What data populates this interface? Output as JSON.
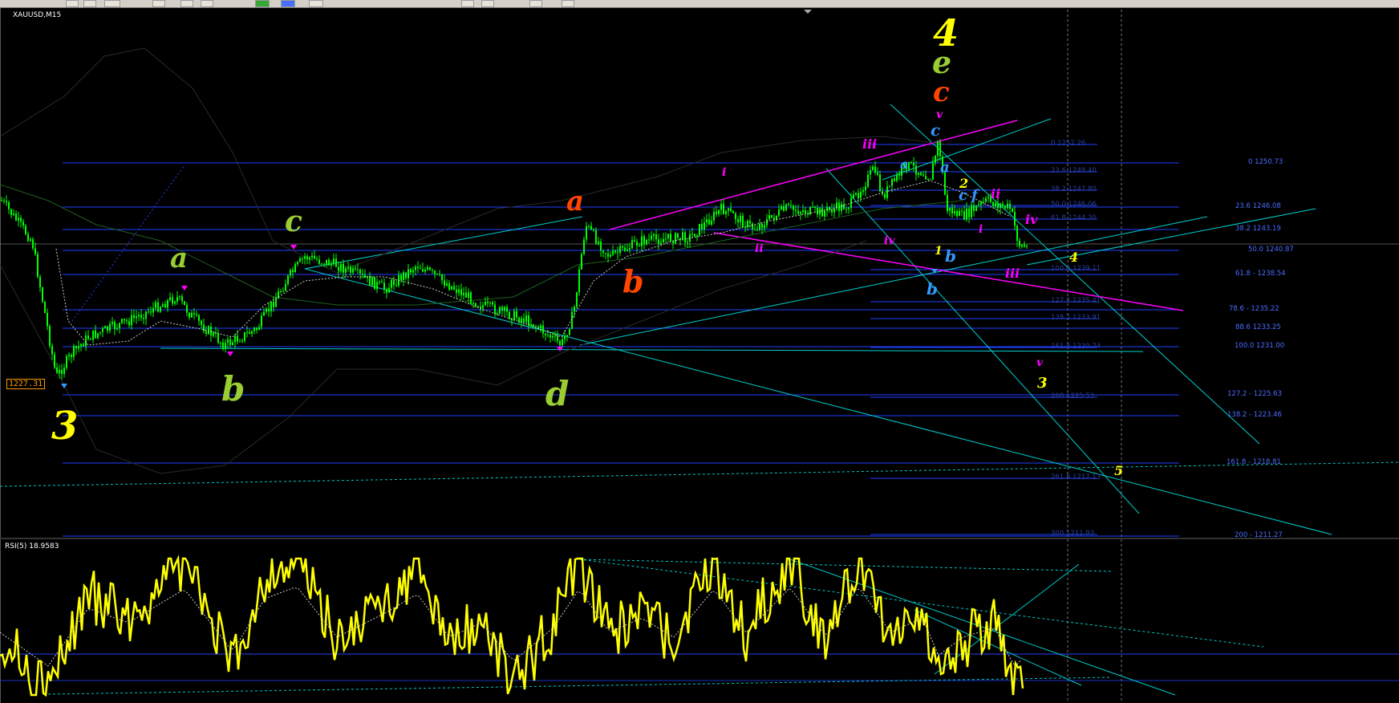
{
  "window": {
    "title": "XAUUSD,M15"
  },
  "rsi": {
    "title": "RSI(5) 18.9583"
  },
  "price_box": "1227.31",
  "colors": {
    "background": "#000000",
    "candles": "#00ff00",
    "fib_lines": "#2040ff",
    "trend_lines": "#00d0d0",
    "magenta_lines": "#ff00ff",
    "rsi_line": "#ffff00"
  },
  "fib_labels_right": [
    {
      "text": "0 1250.73"
    },
    {
      "text": "23.6 1246.08"
    },
    {
      "text": "38.2 1243.19"
    },
    {
      "text": "50.0 1240.87"
    },
    {
      "text": "61.8 - 1238.54"
    },
    {
      "text": "78.6 - 1235.22"
    },
    {
      "text": "88.6 1233.25"
    },
    {
      "text": "100.0 1231.00"
    },
    {
      "text": "127.2 - 1225.63"
    },
    {
      "text": "138.2 - 1223.46"
    },
    {
      "text": "161.8 - 1218.81"
    },
    {
      "text": "200 - 1211.27"
    }
  ],
  "fib_labels_inner": [
    {
      "text": "0 1252.26"
    },
    {
      "text": "23.6 1249.40"
    },
    {
      "text": "38.2 1247.80"
    },
    {
      "text": "50.0 1246.06"
    },
    {
      "text": "61.8 1244.30"
    },
    {
      "text": "100.0 1239.11"
    },
    {
      "text": "127.2 1235.41"
    },
    {
      "text": "138.2 1233.91"
    },
    {
      "text": "161.8 1230.74"
    },
    {
      "text": "200 1225.53"
    },
    {
      "text": "261.8 1217.13"
    },
    {
      "text": "300 1211.93"
    }
  ],
  "wave_labels": [
    {
      "text": "4",
      "color": "#ffff00"
    },
    {
      "text": "e",
      "color": "#9acd32"
    },
    {
      "text": "c",
      "color": "#ff4500"
    },
    {
      "text": "v",
      "color": "#ff00ff"
    },
    {
      "text": "c",
      "color": "#3399ff"
    },
    {
      "text": "iii",
      "color": "#ff00ff"
    },
    {
      "text": "a",
      "color": "#3399ff"
    },
    {
      "text": "a",
      "color": "#3399ff"
    },
    {
      "text": "2",
      "color": "#ffff00"
    },
    {
      "text": "ii",
      "color": "#ff00ff"
    },
    {
      "text": "c",
      "color": "#3399ff"
    },
    {
      "text": "f",
      "color": "#3399ff"
    },
    {
      "text": "iv",
      "color": "#ff00ff"
    },
    {
      "text": "i",
      "color": "#ff00ff"
    },
    {
      "text": "iv",
      "color": "#ff00ff"
    },
    {
      "text": "1",
      "color": "#ffff00"
    },
    {
      "text": "b",
      "color": "#3399ff"
    },
    {
      "text": "4",
      "color": "#ffff00"
    },
    {
      "text": "b",
      "color": "#3399ff"
    },
    {
      "text": "iii",
      "color": "#ff00ff"
    },
    {
      "text": "i",
      "color": "#ff00ff"
    },
    {
      "text": "ii",
      "color": "#ff00ff"
    },
    {
      "text": "a",
      "color": "#ff4500"
    },
    {
      "text": "b",
      "color": "#ff4500"
    },
    {
      "text": "c",
      "color": "#9acd32"
    },
    {
      "text": "a",
      "color": "#9acd32"
    },
    {
      "text": "b",
      "color": "#9acd32"
    },
    {
      "text": "d",
      "color": "#9acd32"
    },
    {
      "text": "3",
      "color": "#ffff00"
    },
    {
      "text": "v",
      "color": "#ff00ff"
    },
    {
      "text": "3",
      "color": "#ffff00"
    },
    {
      "text": "5",
      "color": "#ffff00"
    }
  ]
}
